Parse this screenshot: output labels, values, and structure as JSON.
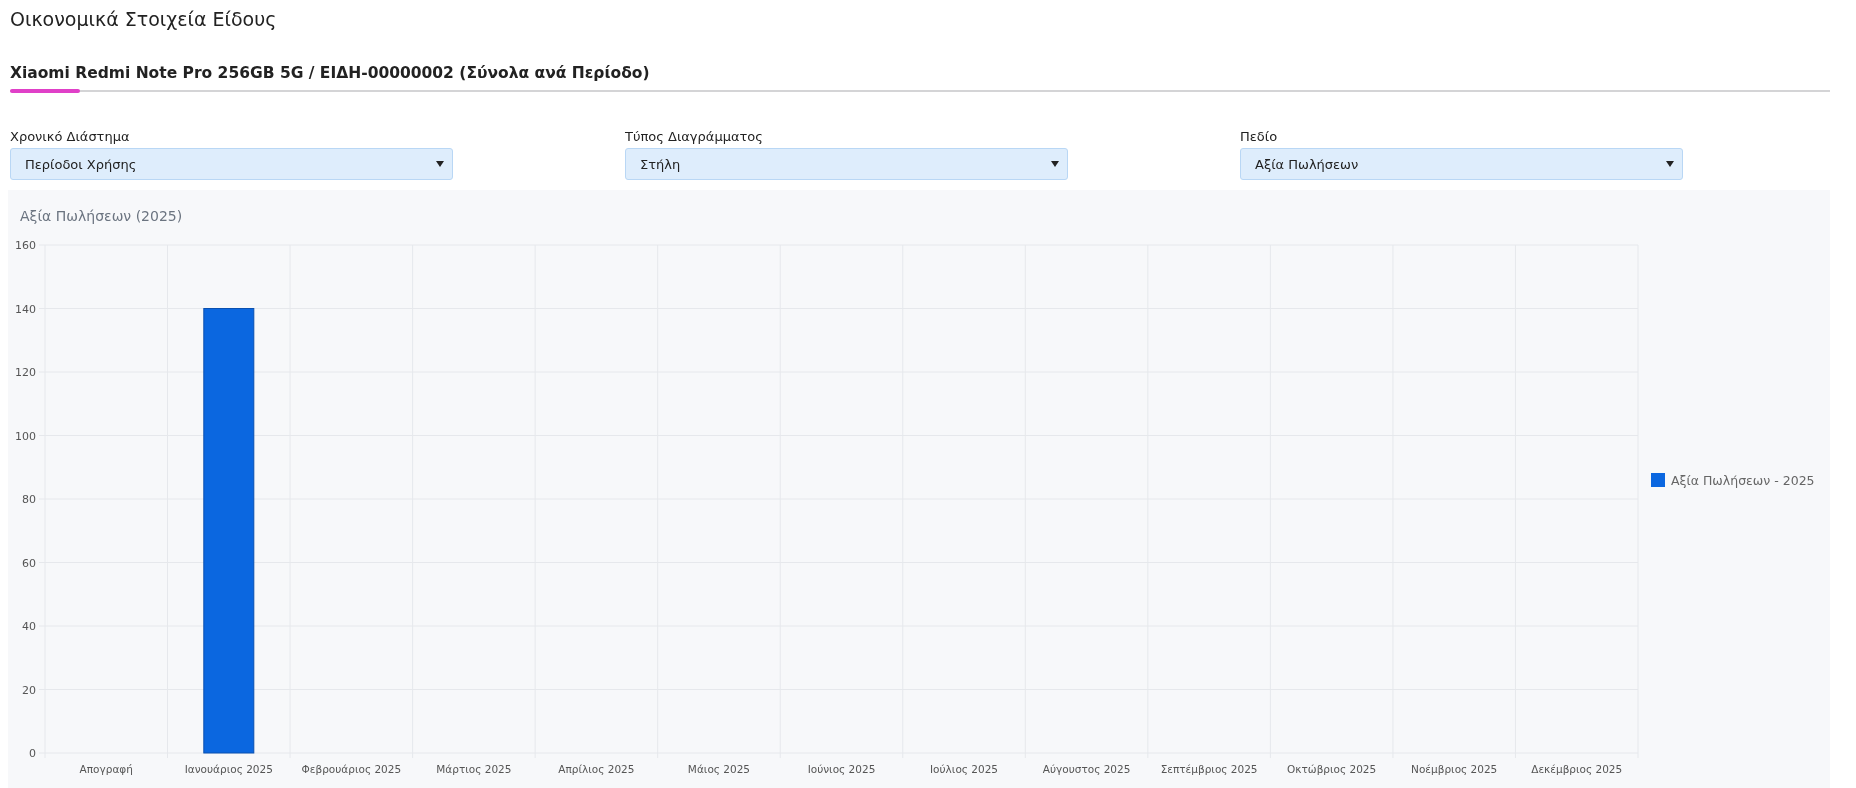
{
  "page": {
    "title": "Οικονομικά Στοιχεία Είδους"
  },
  "tabs": [
    {
      "label": "Xiaomi Redmi Note Pro 256GB 5G / ΕΙΔΗ-00000002 (Σύνολα ανά Περίοδο)",
      "selected": true
    }
  ],
  "filters": [
    {
      "label": "Χρονικό Διάστημα",
      "value": "Περίοδοι Χρήσης"
    },
    {
      "label": "Τύπος Διαγράμματος",
      "value": "Στήλη"
    },
    {
      "label": "Πεδίο",
      "value": "Αξία Πωλήσεων"
    }
  ],
  "chart": {
    "chart_data": {
      "type": "bar",
      "title": "Αξία Πωλήσεων (2025)",
      "categories": [
        "Απογραφή",
        "Ιανουάριος 2025",
        "Φεβρουάριος 2025",
        "Μάρτιος 2025",
        "Απρίλιος 2025",
        "Μάιος 2025",
        "Ιούνιος 2025",
        "Ιούλιος 2025",
        "Αύγουστος 2025",
        "Σεπτέμβριος 2025",
        "Οκτώβριος 2025",
        "Νοέμβριος 2025",
        "Δεκέμβριος 2025"
      ],
      "series": [
        {
          "name": "Αξία Πωλήσεων - 2025",
          "color": "#0b67e0",
          "values": [
            0,
            140,
            0,
            0,
            0,
            0,
            0,
            0,
            0,
            0,
            0,
            0,
            0
          ]
        }
      ],
      "grid": true,
      "ylim": [
        0,
        160
      ],
      "yticks": [
        0,
        20,
        40,
        60,
        80,
        100,
        120,
        140,
        160
      ]
    }
  }
}
